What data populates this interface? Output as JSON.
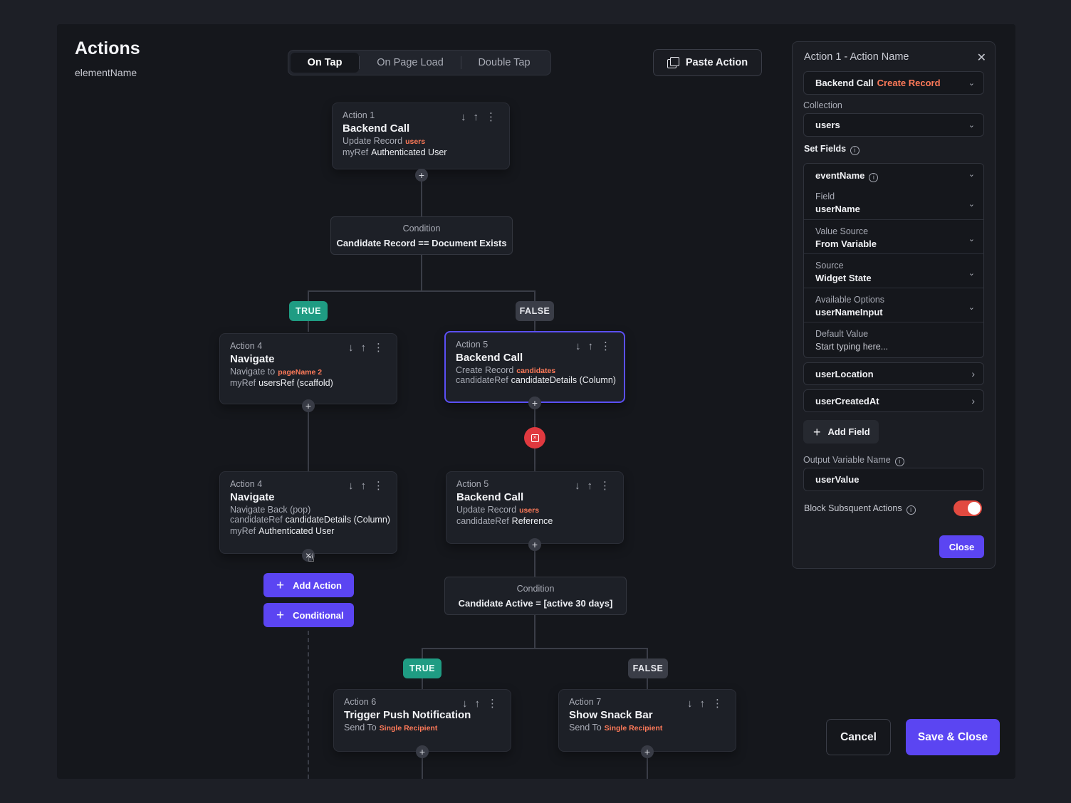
{
  "header": {
    "title": "Actions",
    "subtitle": "elementName"
  },
  "tabs": [
    {
      "label": "On Tap",
      "active": true
    },
    {
      "label": "On Page Load",
      "active": false
    },
    {
      "label": "Double Tap",
      "active": false
    }
  ],
  "paste_action_label": "Paste Action",
  "flow": {
    "action1": {
      "label": "Action 1",
      "name": "Backend Call",
      "line1_text": "Update Record",
      "line1_highlight": "users",
      "line2_key": "myRef",
      "line2_val": "Authenticated User"
    },
    "condition1": {
      "label": "Condition",
      "expr": "Candidate Record == Document Exists"
    },
    "true_label": "TRUE",
    "false_label": "FALSE",
    "action4a": {
      "label": "Action 4",
      "name": "Navigate",
      "line1_text": "Navigate to",
      "line1_highlight": "pageName 2",
      "line2_key": "myRef",
      "line2_val": "usersRef (scaffold)"
    },
    "action5a": {
      "label": "Action 5",
      "name": "Backend Call",
      "line1_text": "Create Record",
      "line1_highlight": "candidates",
      "line2_key": "candidateRef",
      "line2_val": "candidateDetails (Column)"
    },
    "action4b": {
      "label": "Action 4",
      "name": "Navigate",
      "line1_text": "Navigate Back (pop)",
      "line2_key": "candidateRef",
      "line2_val": "candidateDetails (Column)",
      "line3_key": "myRef",
      "line3_val": "Authenticated User"
    },
    "action5b": {
      "label": "Action 5",
      "name": "Backend Call",
      "line1_text": "Update Record",
      "line1_highlight": "users",
      "line2_key": "candidateRef",
      "line2_val": "Reference"
    },
    "add_action_label": "Add Action",
    "conditional_label": "Conditional",
    "condition2": {
      "label": "Condition",
      "expr": "Candidate Active = [active 30 days]"
    },
    "action6": {
      "label": "Action 6",
      "name": "Trigger Push Notification",
      "line1_text": "Send To",
      "line1_highlight": "Single Recipient"
    },
    "action7": {
      "label": "Action 7",
      "name": "Show Snack Bar",
      "line1_text": "Send To",
      "line1_highlight": "Single Recipient"
    }
  },
  "panel": {
    "title": "Action 1 - Action Name",
    "type_main": "Backend Call",
    "type_accent": "Create Record",
    "collection_label": "Collection",
    "collection_value": "users",
    "set_fields_label": "Set Fields",
    "group": {
      "name": "eventName",
      "rows": [
        {
          "k": "Field",
          "v": "userName"
        },
        {
          "k": "Value Source",
          "v": "From Variable"
        },
        {
          "k": "Source",
          "v": "Widget State"
        },
        {
          "k": "Available Options",
          "v": "userNameInput"
        }
      ],
      "default_label": "Default Value",
      "default_placeholder": "Start typing here..."
    },
    "field_location": "userLocation",
    "field_created": "userCreatedAt",
    "add_field_label": "Add Field",
    "output_label": "Output Variable Name",
    "output_value": "userValue",
    "block_label": "Block Subsquent Actions",
    "block_enabled": true,
    "close_label": "Close"
  },
  "footer": {
    "cancel_label": "Cancel",
    "save_label": "Save & Close"
  },
  "colors": {
    "accent": "#5b45f2",
    "highlight": "#ff7a59",
    "true": "#1f9c83",
    "error": "#e0393f"
  },
  "icons": [
    "copy-icon",
    "arrow-down-icon",
    "arrow-up-icon",
    "more-vertical-icon",
    "plus-icon",
    "close-icon",
    "chevron-down-icon",
    "chevron-right-icon",
    "info-icon",
    "pointer-cursor-icon"
  ]
}
